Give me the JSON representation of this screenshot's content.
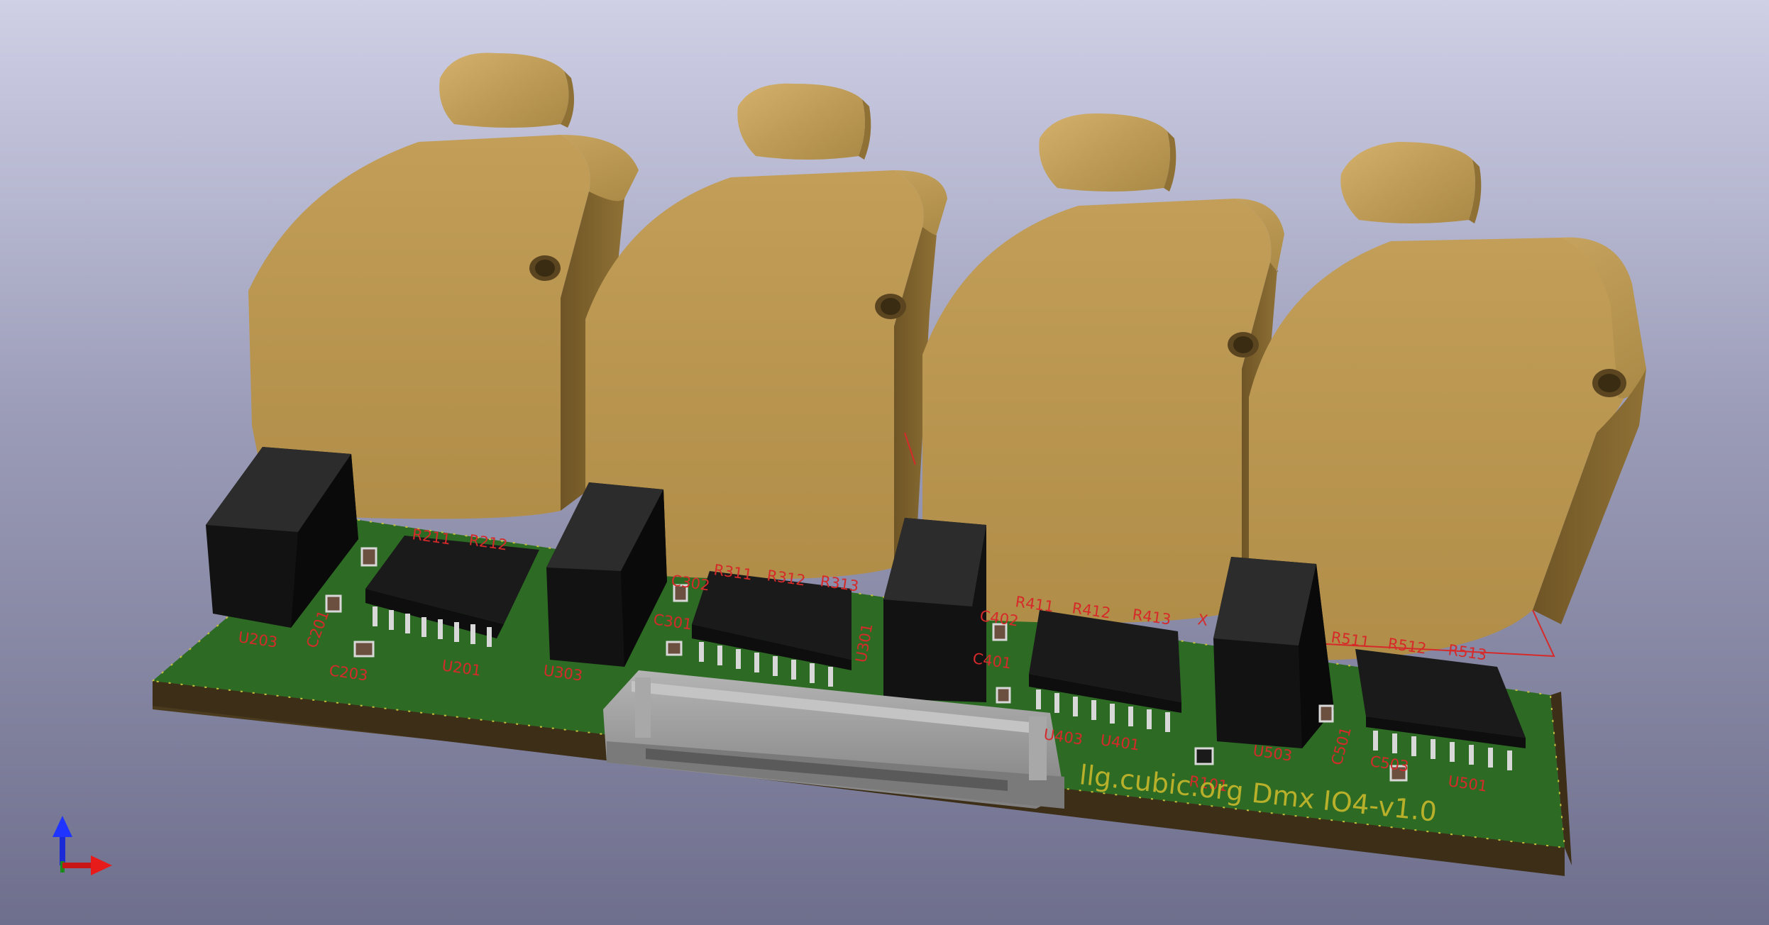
{
  "app": {
    "view": "3D Viewer"
  },
  "board": {
    "label": "llg.cubic.org Dmx IO4-v1.0",
    "refs": {
      "u203": "U203",
      "u201": "U201",
      "c201": "C201",
      "c203": "C203",
      "u303": "U303",
      "u301": "U301",
      "c302": "C302",
      "c301": "C301",
      "u401": "U401",
      "u403": "U403",
      "c402": "C402",
      "c401": "C401",
      "u503": "U503",
      "u501": "U501",
      "c501": "C501",
      "c503": "C503",
      "r101": "R101",
      "x": "X",
      "r211": "R211",
      "r212": "R212",
      "r311": "R311",
      "r312": "R312",
      "r313": "R313",
      "r411": "R411",
      "r412": "R412",
      "r413": "R413",
      "r511": "R511",
      "r512": "R512",
      "r513": "R513"
    }
  },
  "colors": {
    "pcb": "#2d6b24",
    "pcb_edge": "#4a3a1e",
    "connector": "#b8944e",
    "ic": "#1a1a1a",
    "pin": "#d8d8d8",
    "silkscreen": "#d62a2a",
    "ribbon": "#9a9a9a"
  },
  "axes": {
    "x": "red-arrow",
    "y": "green-arrow",
    "z": "blue-arrow"
  }
}
